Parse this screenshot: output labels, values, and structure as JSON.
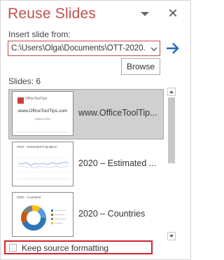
{
  "pane": {
    "title": "Reuse Slides",
    "menu_icon": "chevron-down-icon",
    "close_icon": "close-icon",
    "close_glyph": "✕"
  },
  "insert": {
    "label": "Insert slide from:",
    "path_value": "C:\\Users\\Olga\\Documents\\OTT-2020.",
    "go_icon": "arrow-right-icon",
    "browse_label": "Browse"
  },
  "slides": {
    "count_label": "Slides: 6",
    "items": [
      {
        "title": "www.OfficeToolTip...",
        "thumb": {
          "logo_text": "OfficeToolTips",
          "center_text": "www.OfficeToolTips.com",
          "sub_text": "Report 2020"
        }
      },
      {
        "title": "2020 – Estimated ...",
        "thumb": {
          "heading": "2020 – Estimated Population"
        }
      },
      {
        "title": "2020 – Countries",
        "thumb": {
          "heading": "2020 – Countries"
        }
      }
    ]
  },
  "footer": {
    "keep_source_label": "Keep source formatting",
    "keep_source_checked": false
  },
  "colors": {
    "accent_title": "#c0504d",
    "highlight_red": "#d4232d",
    "go_arrow": "#2b6cbf",
    "selected_bg": "#d0d0d0"
  }
}
